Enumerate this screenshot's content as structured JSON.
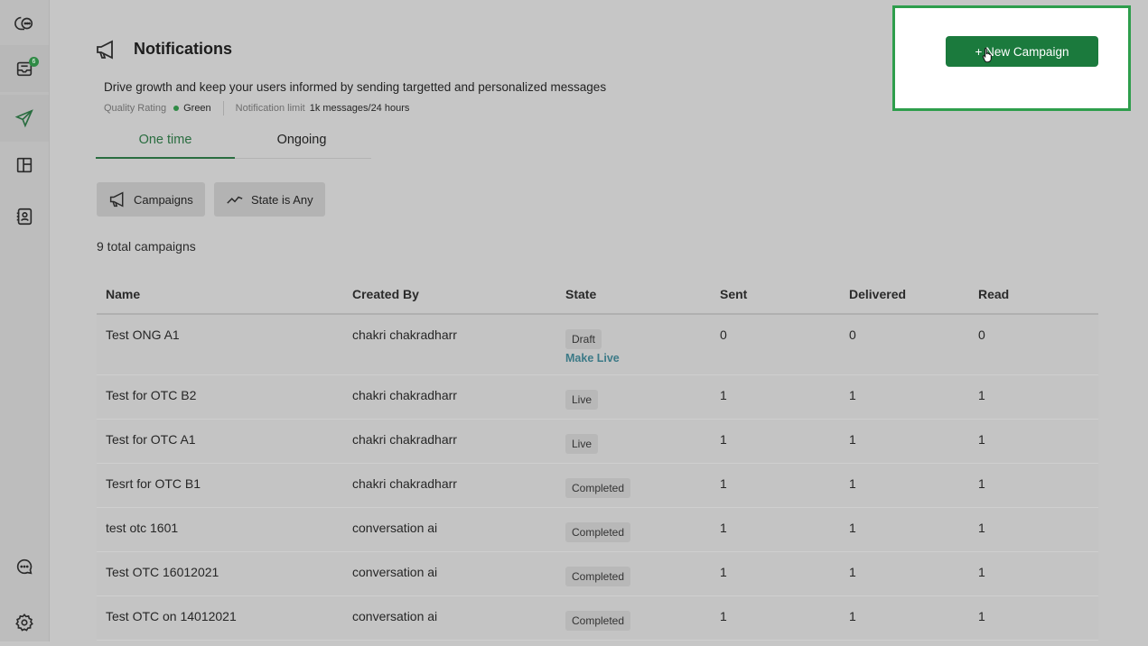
{
  "sidebar": {
    "badge_count": "6"
  },
  "page": {
    "title": "Notifications",
    "subtitle": "Drive growth and keep your users informed by sending targetted and personalized messages",
    "quality_label": "Quality Rating",
    "quality_value": "Green",
    "limit_label": "Notification limit",
    "limit_value": "1k messages/24 hours"
  },
  "tabs": [
    {
      "label": "One time"
    },
    {
      "label": "Ongoing"
    }
  ],
  "filters": {
    "campaigns_label": "Campaigns",
    "state_label": "State is Any"
  },
  "total_label": "9 total campaigns",
  "new_campaign_label": "+ New Campaign",
  "table": {
    "headers": [
      "Name",
      "Created By",
      "State",
      "Sent",
      "Delivered",
      "Read"
    ],
    "make_live_label": "Make Live",
    "rows": [
      {
        "name": "Test ONG A1",
        "created_by": "chakri chakradharr",
        "state": "Draft",
        "sent": "0",
        "delivered": "0",
        "read": "0"
      },
      {
        "name": "Test for OTC B2",
        "created_by": "chakri chakradharr",
        "state": "Live",
        "sent": "1",
        "delivered": "1",
        "read": "1"
      },
      {
        "name": "Test for OTC A1",
        "created_by": "chakri chakradharr",
        "state": "Live",
        "sent": "1",
        "delivered": "1",
        "read": "1"
      },
      {
        "name": "Tesrt for OTC B1",
        "created_by": "chakri chakradharr",
        "state": "Completed",
        "sent": "1",
        "delivered": "1",
        "read": "1"
      },
      {
        "name": "test otc 1601",
        "created_by": "conversation ai",
        "state": "Completed",
        "sent": "1",
        "delivered": "1",
        "read": "1"
      },
      {
        "name": "Test OTC 16012021",
        "created_by": "conversation ai",
        "state": "Completed",
        "sent": "1",
        "delivered": "1",
        "read": "1"
      },
      {
        "name": "Test OTC on 14012021",
        "created_by": "conversation ai",
        "state": "Completed",
        "sent": "1",
        "delivered": "1",
        "read": "1"
      }
    ]
  },
  "colors": {
    "accent": "#1b7a3d",
    "highlight_border": "#2e9e4c",
    "link": "#3c7a87"
  }
}
